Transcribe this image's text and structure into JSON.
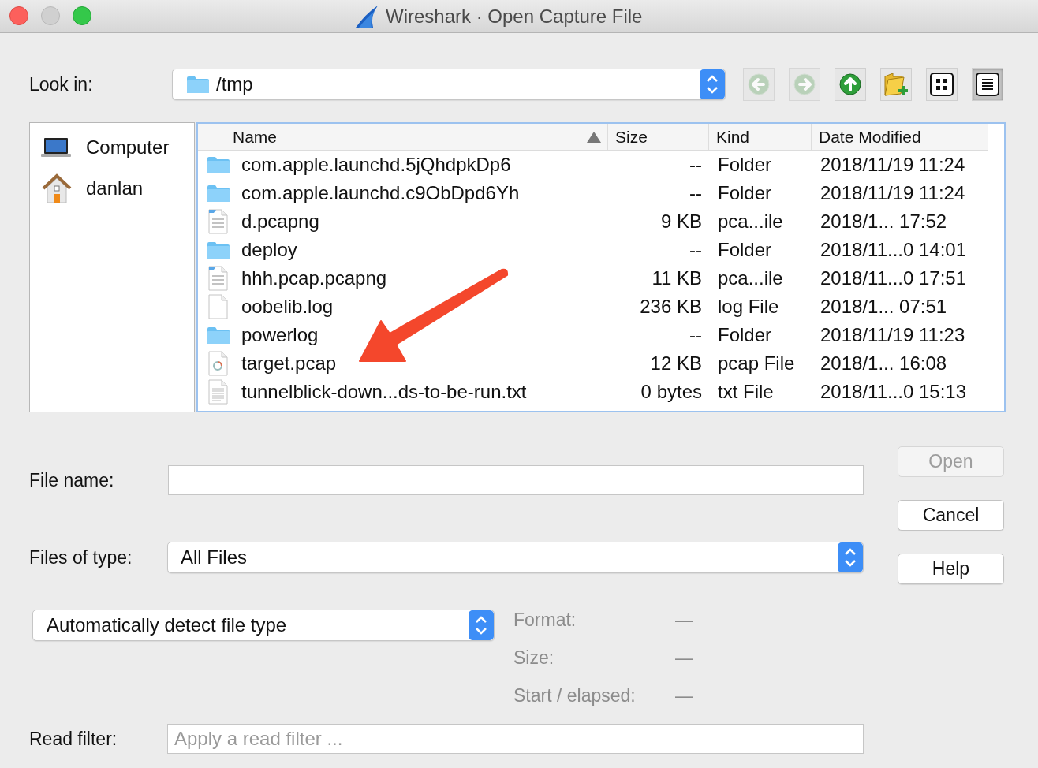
{
  "window": {
    "title": "Wireshark · Open Capture File"
  },
  "look_in": {
    "label": "Look in:",
    "path": "/tmp"
  },
  "toolbar": [
    {
      "kind": "back",
      "disabled": true,
      "selected": false
    },
    {
      "kind": "forward",
      "disabled": true,
      "selected": false
    },
    {
      "kind": "up",
      "disabled": false,
      "selected": false
    },
    {
      "kind": "new_folder",
      "disabled": false,
      "selected": false
    },
    {
      "kind": "icon_view",
      "disabled": false,
      "selected": false
    },
    {
      "kind": "detail_view",
      "disabled": false,
      "selected": true
    }
  ],
  "sidebar": {
    "items": [
      {
        "kind": "computer",
        "label": "Computer"
      },
      {
        "kind": "home",
        "label": "danlan"
      }
    ]
  },
  "table": {
    "columns": [
      {
        "label": "Name",
        "sorted": true
      },
      {
        "label": "Size",
        "sorted": false
      },
      {
        "label": "Kind",
        "sorted": false
      },
      {
        "label": "Date Modified",
        "sorted": false
      }
    ],
    "rows": [
      {
        "kind": "folder",
        "name": "com.apple.launchd.5jQhdpkDp6",
        "size": "--",
        "type": "Folder",
        "date": "2018/11/19 11:24"
      },
      {
        "kind": "folder",
        "name": "com.apple.launchd.c9ObDpd6Yh",
        "size": "--",
        "type": "Folder",
        "date": "2018/11/19 11:24"
      },
      {
        "kind": "capture",
        "name": "d.pcapng",
        "size": "9 KB",
        "type": "pca...ile",
        "date": "2018/1... 17:52"
      },
      {
        "kind": "folder",
        "name": "deploy",
        "size": "--",
        "type": "Folder",
        "date": "2018/11...0 14:01"
      },
      {
        "kind": "capture",
        "name": "hhh.pcap.pcapng",
        "size": "11 KB",
        "type": "pca...ile",
        "date": "2018/11...0 17:51"
      },
      {
        "kind": "blank",
        "name": "oobelib.log",
        "size": "236 KB",
        "type": "log File",
        "date": "2018/1... 07:51"
      },
      {
        "kind": "folder",
        "name": "powerlog",
        "size": "--",
        "type": "Folder",
        "date": "2018/11/19 11:23"
      },
      {
        "kind": "pcap",
        "name": "target.pcap",
        "size": "12 KB",
        "type": "pcap File",
        "date": "2018/1... 16:08"
      },
      {
        "kind": "text",
        "name": "tunnelblick-down...ds-to-be-run.txt",
        "size": "0 bytes",
        "type": "txt File",
        "date": "2018/11...0 15:13"
      }
    ]
  },
  "file_name": {
    "label": "File name:"
  },
  "files_of_type": {
    "label": "Files of type:",
    "value": "All Files"
  },
  "format_select": {
    "value": "Automatically detect file type"
  },
  "info": [
    {
      "label": "Format:",
      "value": "—",
      "disabled": true
    },
    {
      "label": "Size:",
      "value": "—",
      "disabled": true
    },
    {
      "label": "Start / elapsed:",
      "value": "—",
      "disabled": true
    }
  ],
  "read_filter": {
    "label": "Read filter:",
    "placeholder": "Apply a read filter ..."
  },
  "buttons": [
    {
      "label": "Open",
      "disabled": true
    },
    {
      "label": "Cancel",
      "disabled": false
    },
    {
      "label": "Help",
      "disabled": false
    }
  ]
}
